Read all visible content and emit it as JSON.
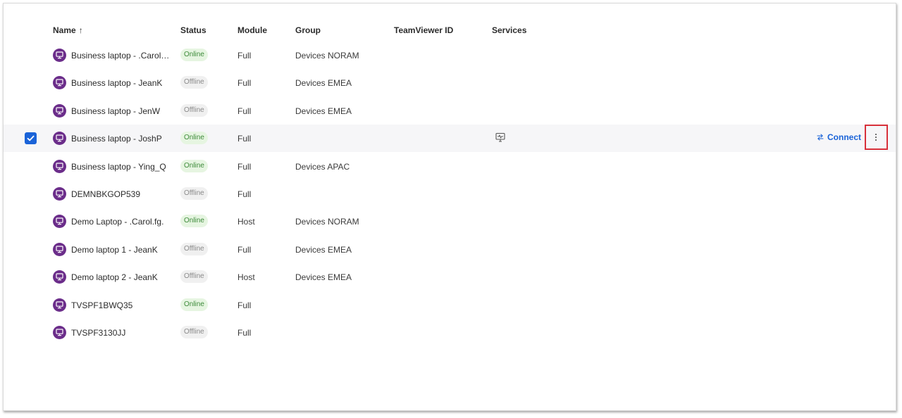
{
  "columns": {
    "name": "Name",
    "sort_indicator": "↑",
    "status": "Status",
    "module": "Module",
    "group": "Group",
    "teamviewer_id": "TeamViewer ID",
    "services": "Services"
  },
  "rows": [
    {
      "name": "Business laptop - .Carol.f...",
      "status": "Online",
      "module": "Full",
      "group": "Devices NORAM"
    },
    {
      "name": "Business laptop - JeanK",
      "status": "Offline",
      "module": "Full",
      "group": "Devices EMEA"
    },
    {
      "name": "Business laptop - JenW",
      "status": "Offline",
      "module": "Full",
      "group": "Devices EMEA"
    },
    {
      "name": "Business laptop - JoshP",
      "status": "Online",
      "module": "Full",
      "group": "",
      "selected": true
    },
    {
      "name": "Business laptop - Ying_Q",
      "status": "Online",
      "module": "Full",
      "group": "Devices APAC"
    },
    {
      "name": "DEMNBKGOP539",
      "status": "Offline",
      "module": "Full",
      "group": ""
    },
    {
      "name": "Demo Laptop - .Carol.fg.",
      "status": "Online",
      "module": "Host",
      "group": "Devices NORAM"
    },
    {
      "name": "Demo laptop 1 - JeanK",
      "status": "Offline",
      "module": "Full",
      "group": "Devices EMEA"
    },
    {
      "name": "Demo laptop 2 - JeanK",
      "status": "Offline",
      "module": "Host",
      "group": "Devices EMEA"
    },
    {
      "name": "TVSPF1BWQ35",
      "status": "Online",
      "module": "Full",
      "group": ""
    },
    {
      "name": "TVSPF3130JJ",
      "status": "Offline",
      "module": "Full",
      "group": ""
    }
  ],
  "selected_row_actions": {
    "connect_label": "Connect",
    "service_icon": "remote-monitoring-icon",
    "more_icon": "more-vertical-icon"
  },
  "colors": {
    "accent": "#1a63d8",
    "device_icon": "#6b2d8a",
    "online_bg": "#e6f5e1",
    "online_text": "#3d8a3a",
    "offline_bg": "#f0f0f0",
    "offline_text": "#8a8a8a",
    "highlight_border": "#d8303a"
  }
}
